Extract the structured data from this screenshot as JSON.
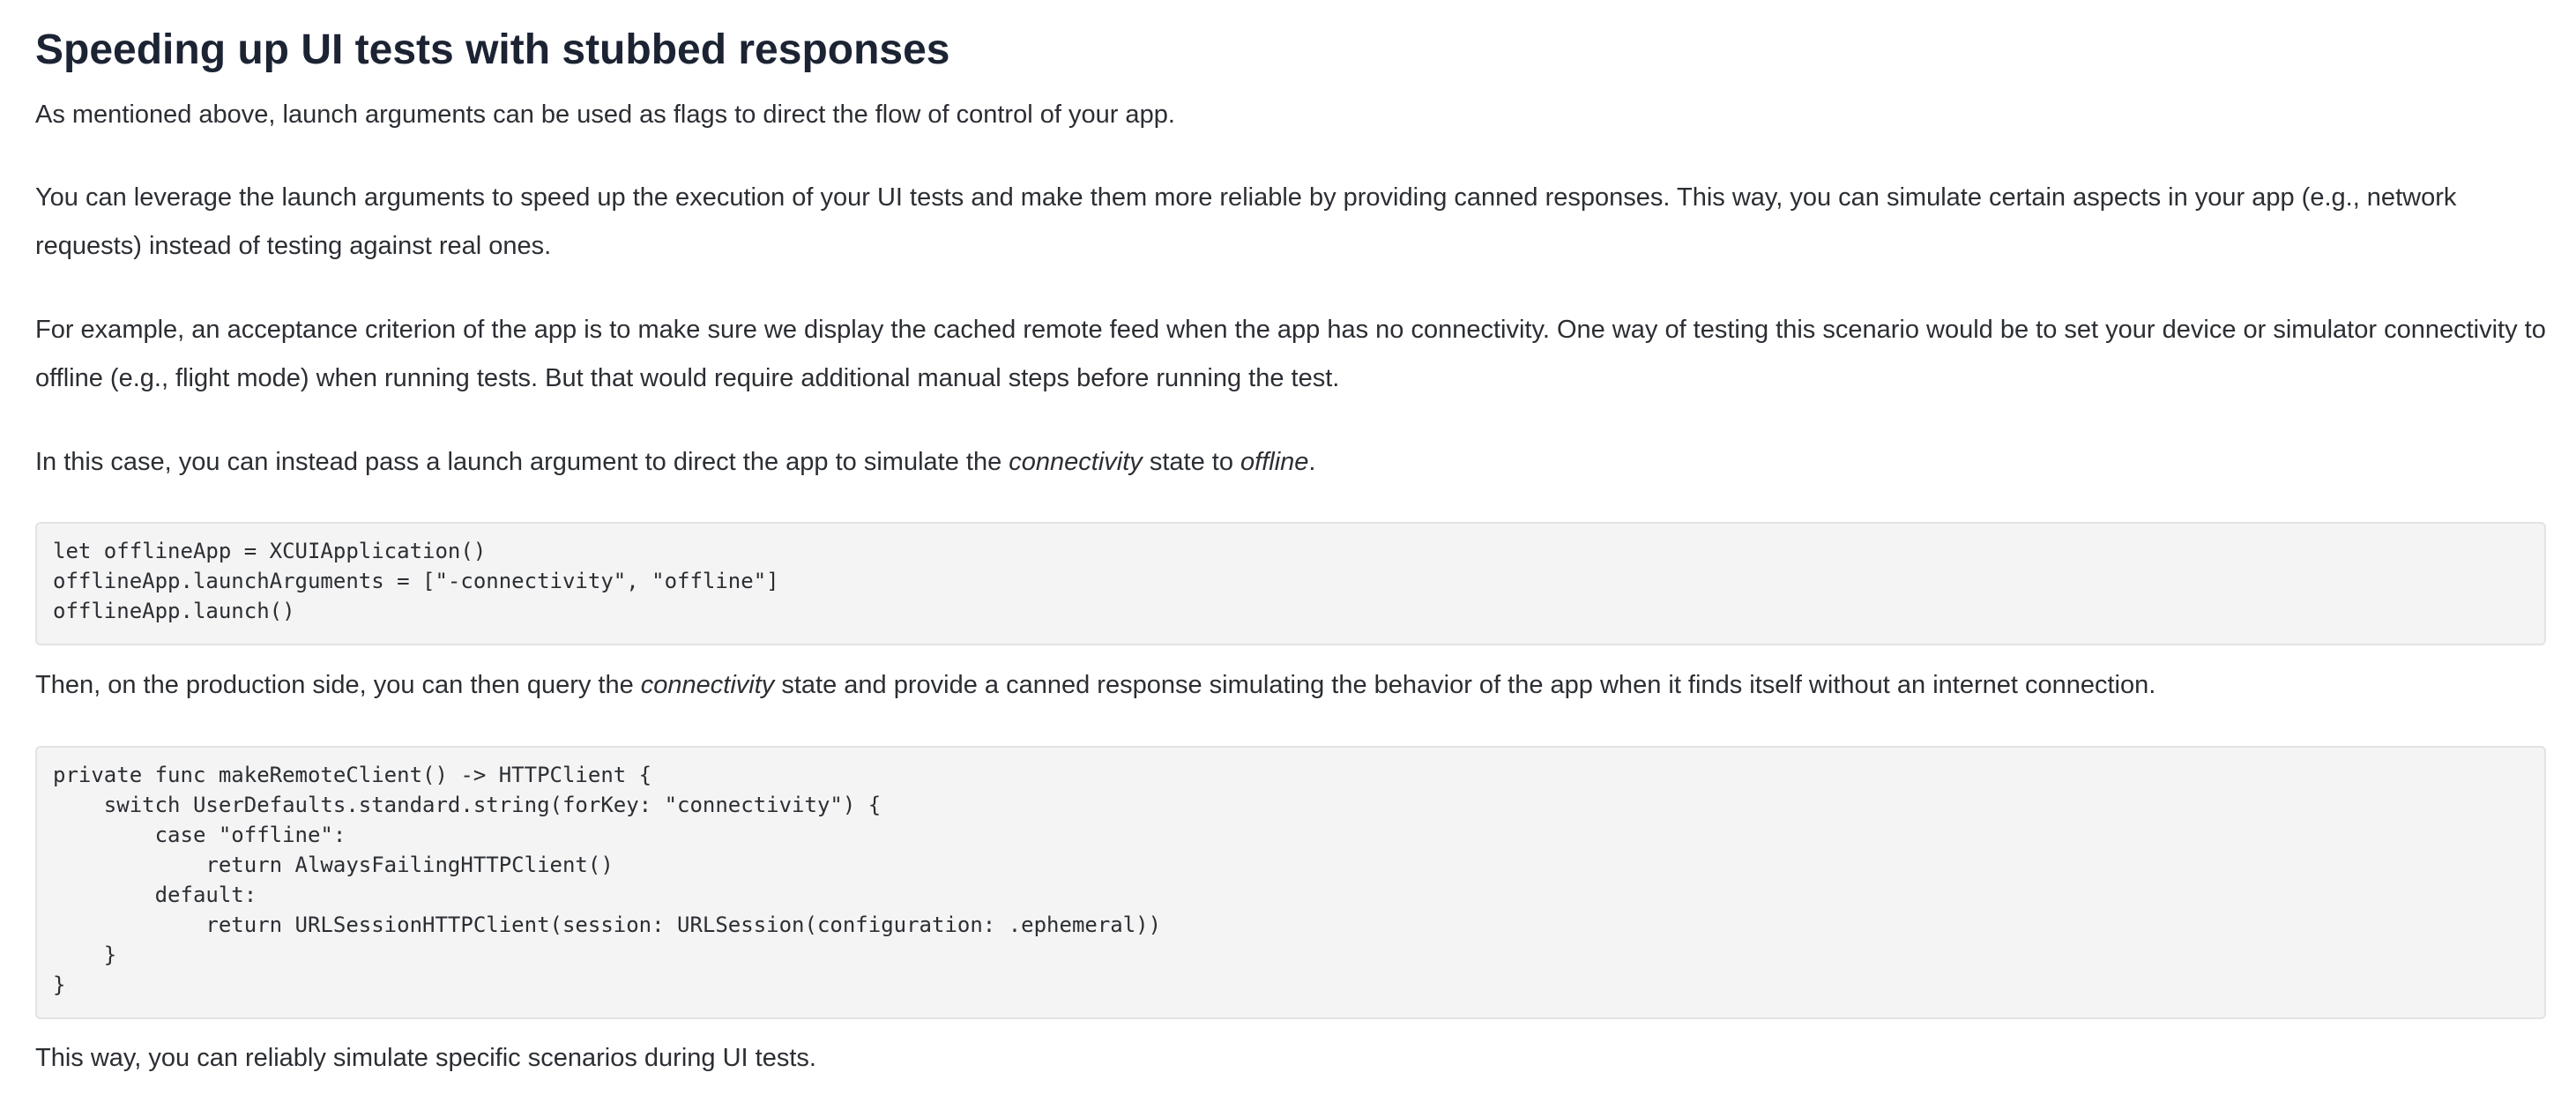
{
  "article": {
    "heading": "Speeding up UI tests with stubbed responses",
    "p1": "As mentioned above, launch arguments can be used as flags to direct the flow of control of your app.",
    "p2": "You can leverage the launch arguments to speed up the execution of your UI tests and make them more reliable by providing canned responses. This way, you can simulate certain aspects in your app (e.g., network requests) instead of testing against real ones.",
    "p3": "For example, an acceptance criterion of the app is to make sure we display the cached remote feed when the app has no connectivity. One way of testing this scenario would be to set your device or simulator connectivity to offline (e.g., flight mode) when running tests. But that would require additional manual steps before running the test.",
    "p4": {
      "before": "In this case, you can instead pass a launch argument to direct the app to simulate the ",
      "em1": "connectivity",
      "middle": " state to ",
      "em2": "offline",
      "after": "."
    },
    "code1": [
      "let offlineApp = XCUIApplication()",
      "offlineApp.launchArguments = [\"-connectivity\", \"offline\"]",
      "offlineApp.launch()"
    ],
    "p5": {
      "before": "Then, on the production side, you can then query the ",
      "em": "connectivity",
      "after": " state and provide a canned response simulating the behavior of the app when it finds itself without an internet connection."
    },
    "code2": [
      "private func makeRemoteClient() -> HTTPClient {",
      "    switch UserDefaults.standard.string(forKey: \"connectivity\") {",
      "        case \"offline\":",
      "            return AlwaysFailingHTTPClient()",
      "        default:",
      "            return URLSessionHTTPClient(session: URLSession(configuration: .ephemeral))",
      "    }",
      "}"
    ],
    "p6": "This way, you can reliably simulate specific scenarios during UI tests."
  }
}
